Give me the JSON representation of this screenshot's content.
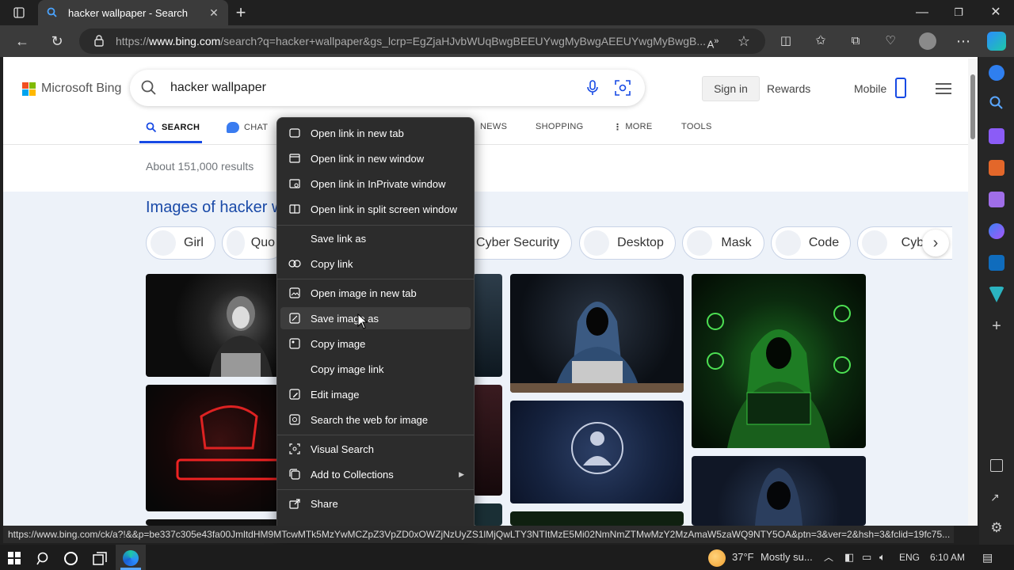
{
  "browser": {
    "tab_title": "hacker wallpaper - Search",
    "url_prefix": "https://",
    "url_domain": "www.bing.com",
    "url_rest": "/search?q=hacker+wallpaper&gs_lcrp=EgZjaHJvbWUqBwgBEEUYwgMyBwgAEEUYwgMyBwgB..."
  },
  "bing": {
    "logo_text": "Microsoft Bing",
    "query": "hacker wallpaper",
    "sign_in": "Sign in",
    "rewards": "Rewards",
    "mobile": "Mobile",
    "tabs": {
      "search": "SEARCH",
      "chat": "CHAT",
      "news": "NEWS",
      "shopping": "SHOPPING",
      "more": "MORE",
      "tools": "TOOLS"
    },
    "results_count": "About 151,000 results",
    "images_heading": "Images of hacker w",
    "chips": {
      "girl": "Girl",
      "quo": "Quo",
      "cyber_security": "Cyber Security",
      "desktop": "Desktop",
      "mask": "Mask",
      "code": "Code",
      "cyber_partial": "Cyber"
    }
  },
  "context_menu": {
    "items": [
      "Open link in new tab",
      "Open link in new window",
      "Open link in InPrivate window",
      "Open link in split screen window",
      "Save link as",
      "Copy link",
      "Open image in new tab",
      "Save image as",
      "Copy image",
      "Copy image link",
      "Edit image",
      "Search the web for image",
      "Visual Search",
      "Add to Collections",
      "Share"
    ]
  },
  "status_url": "https://www.bing.com/ck/a?!&&p=be337c305e43fa00JmltdHM9MTcwMTk5MzYwMCZpZ3VpZD0xOWZjNzUyZS1lMjQwLTY3NTItMzE5Mi02NmNmZTMwMzY2MzAmaW5zaWQ9NTY5OA&ptn=3&ver=2&hsh=3&fclid=19fc75...",
  "taskbar": {
    "weather_temp": "37°F",
    "weather_desc": "Mostly su...",
    "language": "ENG",
    "time": "6:10 AM"
  },
  "colors": {
    "bing_blue": "#174ae4",
    "heading_blue": "#1a4aa8",
    "menu_bg": "#2c2c2c"
  }
}
